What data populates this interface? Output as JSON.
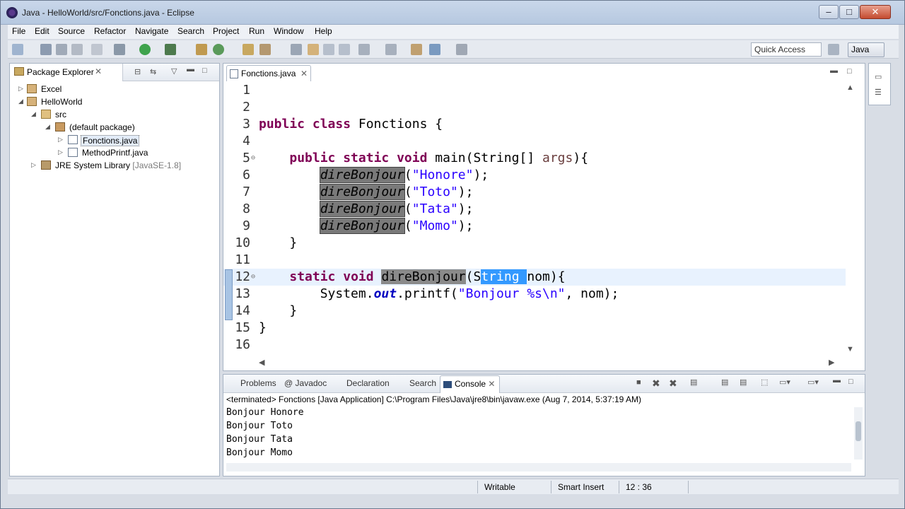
{
  "window": {
    "title": "Java - HelloWorld/src/Fonctions.java - Eclipse",
    "min": "–",
    "max": "□",
    "close": "✕"
  },
  "menu": [
    "File",
    "Edit",
    "Source",
    "Refactor",
    "Navigate",
    "Search",
    "Project",
    "Run",
    "Window",
    "Help"
  ],
  "toolbar": {
    "quick_access": "Quick Access",
    "perspective": "Java"
  },
  "package_explorer": {
    "tab": "Package Explorer",
    "items": [
      {
        "label": "Excel"
      },
      {
        "label": "HelloWorld"
      },
      {
        "label": "src"
      },
      {
        "label": "(default package)"
      },
      {
        "label": "Fonctions.java"
      },
      {
        "label": "MethodPrintf.java"
      },
      {
        "label": "JRE System Library",
        "suffix": "[JavaSE-1.8]"
      }
    ]
  },
  "editor": {
    "tab": "Fonctions.java",
    "lines": [
      "1",
      "2",
      "3",
      "4",
      "5",
      "6",
      "7",
      "8",
      "9",
      "10",
      "11",
      "12",
      "13",
      "14",
      "15",
      "16"
    ],
    "code": {
      "l3_kw": "public class",
      "l3_rest": " Fonctions {",
      "l5_kw": "public static void",
      "l5_rest": " main(String[] ",
      "l5_args": "args",
      "l5_end": "){",
      "call": "direBonjour",
      "s6": "\"Honore\"",
      "s7": "\"Toto\"",
      "s8": "\"Tata\"",
      "s9": "\"Momo\"",
      "callend": ");",
      "l10": "}",
      "l12_kw1": "static",
      "l12_kw2": "void",
      "l12_name": "direBonjour",
      "l12_p1": "(S",
      "l12_sel": "tring ",
      "l12_p2": "nom){",
      "l13_a": "System.",
      "l13_out": "out",
      "l13_b": ".printf(",
      "l13_str": "\"Bonjour %s\\n\"",
      "l13_c": ", nom);",
      "l14": "}",
      "l15": "}"
    }
  },
  "console": {
    "tabs": [
      "Problems",
      "@ Javadoc",
      "Declaration",
      "Search",
      "Console"
    ],
    "description": "<terminated> Fonctions [Java Application] C:\\Program Files\\Java\\jre8\\bin\\javaw.exe (Aug 7, 2014, 5:37:19 AM)",
    "output": [
      "Bonjour Honore",
      "Bonjour Toto",
      "Bonjour Tata",
      "Bonjour Momo"
    ]
  },
  "status": {
    "writable": "Writable",
    "insert": "Smart Insert",
    "position": "12 : 36"
  }
}
